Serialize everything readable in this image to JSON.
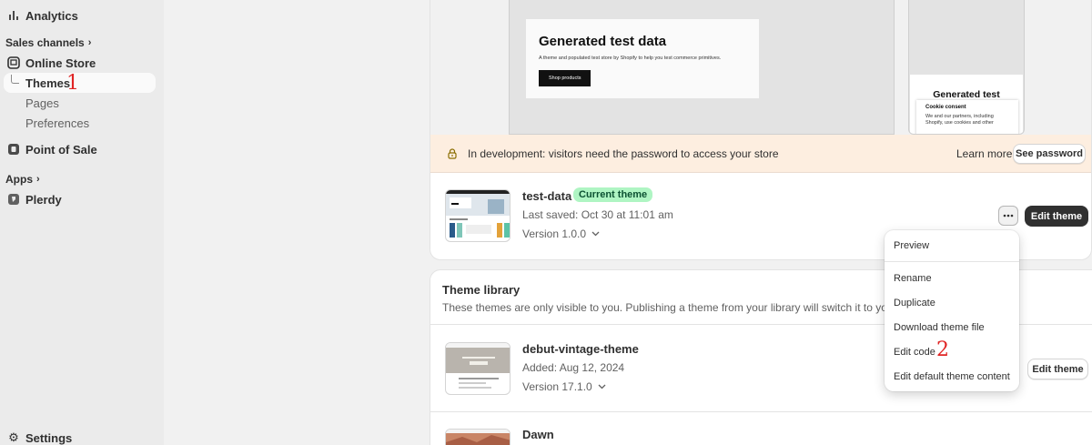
{
  "sidebar": {
    "analytics": "Analytics",
    "sales_channels": "Sales channels",
    "online_store": "Online Store",
    "themes": "Themes",
    "pages": "Pages",
    "preferences": "Preferences",
    "point_of_sale": "Point of Sale",
    "apps": "Apps",
    "plerdy": "Plerdy",
    "settings": "Settings"
  },
  "annotations": {
    "step1": "1",
    "step2": "2"
  },
  "preview": {
    "desktop_title": "Generated test data",
    "desktop_desc": "A theme and populated test store by Shopify to help you test commerce primitives.",
    "shop_button": "Shop products",
    "mobile_title": "Generated test",
    "cookie_title": "Cookie consent",
    "cookie_text": "We and our partners, including Shopify, use cookies and other"
  },
  "banner": {
    "text": "In development: visitors need the password to access your store",
    "learn_more": "Learn more",
    "see_password": "See password"
  },
  "current_theme": {
    "name": "test-data",
    "badge": "Current theme",
    "last_saved": "Last saved: Oct 30 at 11:01 am",
    "version": "Version 1.0.0",
    "edit_button": "Edit theme"
  },
  "menu": {
    "preview": "Preview",
    "rename": "Rename",
    "duplicate": "Duplicate",
    "download": "Download theme file",
    "edit_code": "Edit code",
    "edit_default": "Edit default theme content"
  },
  "library": {
    "title": "Theme library",
    "subtitle": "These themes are only visible to you. Publishing a theme from your library will switch it to your curre",
    "themes": [
      {
        "name": "debut-vintage-theme",
        "added": "Added: Aug 12, 2024",
        "version": "Version 17.1.0",
        "edit_button": "Edit theme"
      },
      {
        "name": "Dawn"
      }
    ]
  },
  "colors": {
    "badge_bg": "#aff5c3",
    "banner_bg": "#fdeee0",
    "annotation": "#e02424",
    "primary_button": "#303030"
  }
}
